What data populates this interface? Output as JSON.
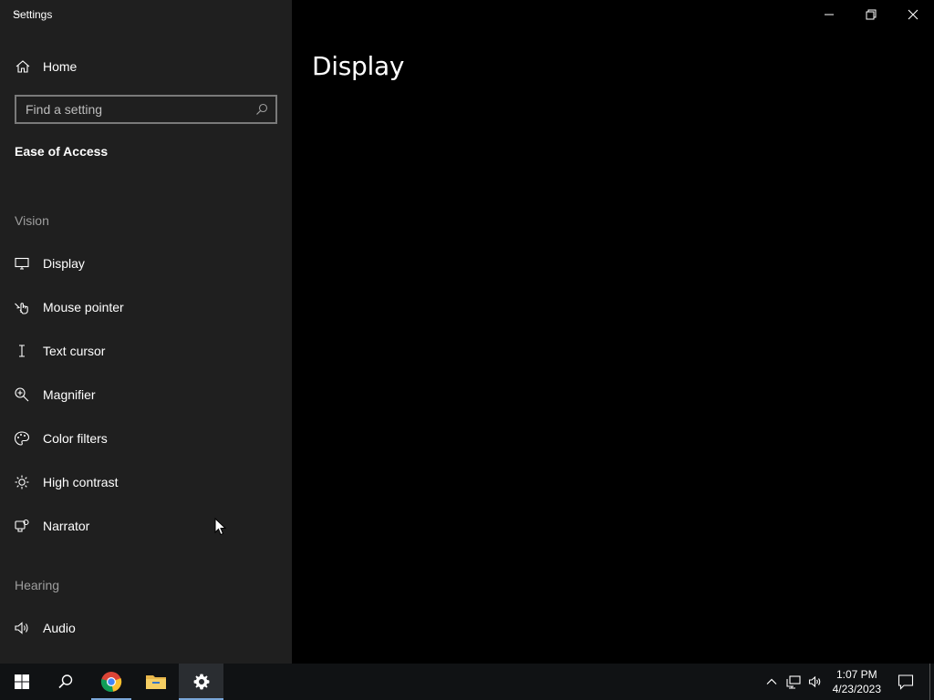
{
  "window": {
    "title": "Settings",
    "back_glyph": "←",
    "caption_icons": [
      "minimize-icon",
      "restore-icon",
      "close-icon"
    ]
  },
  "sidebar": {
    "home_label": "Home",
    "search_placeholder": "Find a setting",
    "section_title": "Ease of Access",
    "groups": [
      {
        "label": "Vision",
        "items": [
          {
            "label": "Display",
            "icon": "display-icon"
          },
          {
            "label": "Mouse pointer",
            "icon": "mouse-pointer-icon"
          },
          {
            "label": "Text cursor",
            "icon": "text-cursor-icon"
          },
          {
            "label": "Magnifier",
            "icon": "magnifier-icon"
          },
          {
            "label": "Color filters",
            "icon": "color-filters-icon"
          },
          {
            "label": "High contrast",
            "icon": "high-contrast-icon"
          },
          {
            "label": "Narrator",
            "icon": "narrator-icon"
          }
        ]
      },
      {
        "label": "Hearing",
        "items": [
          {
            "label": "Audio",
            "icon": "audio-icon"
          }
        ]
      }
    ]
  },
  "main": {
    "page_title": "Display"
  },
  "taskbar": {
    "apps": [
      "start-icon",
      "search-icon",
      "chrome-icon",
      "file-explorer-icon",
      "settings-icon"
    ],
    "active_app": "settings-icon",
    "tray": [
      "chevron-up-icon",
      "network-icon",
      "volume-icon"
    ],
    "time": "1:07 PM",
    "date": "4/23/2023"
  },
  "colors": {
    "sidebar_bg": "#1f1f1f",
    "content_bg": "#000000",
    "taskbar_bg": "#101214",
    "accent": "#7aa7d9"
  }
}
